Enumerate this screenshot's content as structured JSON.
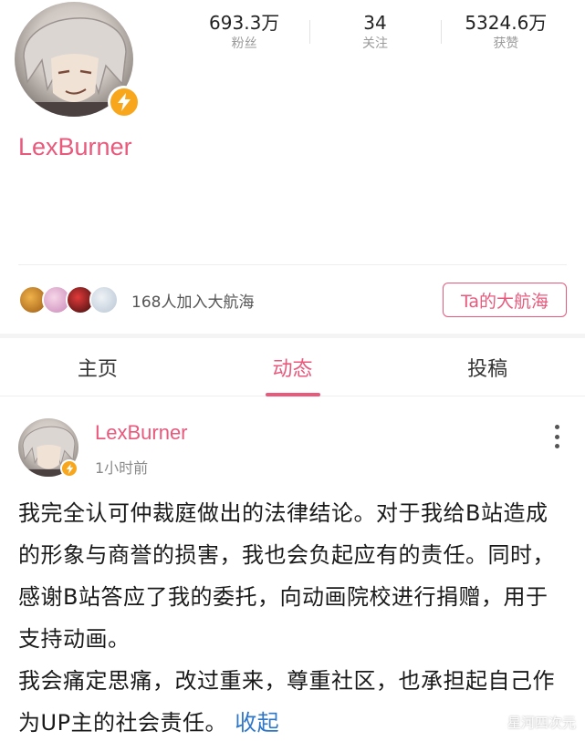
{
  "profile": {
    "username": "LexBurner",
    "stats": [
      {
        "value": "693.3万",
        "label": "粉丝"
      },
      {
        "value": "34",
        "label": "关注"
      },
      {
        "value": "5324.6万",
        "label": "获赞"
      }
    ],
    "verified_icon": "lightning-icon"
  },
  "crew": {
    "text": "168人加入大航海",
    "button": "Ta的大航海"
  },
  "tabs": [
    "主页",
    "动态",
    "投稿"
  ],
  "active_tab": "动态",
  "post": {
    "author": "LexBurner",
    "time": "1小时前",
    "paragraph1": "我完全认可仲裁庭做出的法律结论。对于我给B站造成的形象与商誉的损害，我也会负起应有的责任。同时，感谢B站答应了我的委托，向动画院校进行捐赠，用于支持动画。",
    "paragraph2": "我会痛定思痛，改过重来，尊重社区，也承担起自己作为UP主的社会责任。",
    "collapse_label": "收起"
  },
  "watermark": "星河四次元",
  "colors": {
    "accent": "#e8597c",
    "badge": "#f8a61b",
    "link": "#2e77c9"
  }
}
